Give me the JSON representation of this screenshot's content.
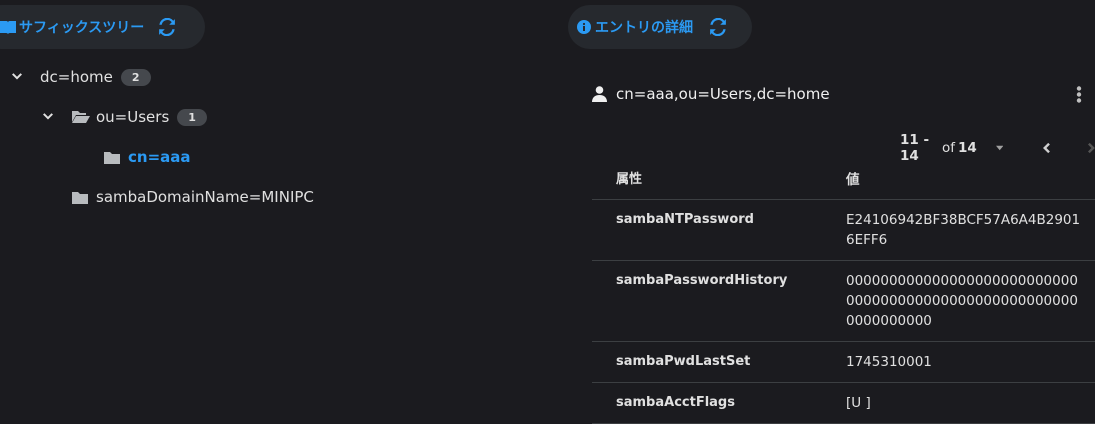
{
  "left_panel": {
    "title": "サフィックスツリー",
    "title_icon": "book-icon",
    "refresh_icon": "sync-icon"
  },
  "tree": [
    {
      "label": "dc=home",
      "count": "2",
      "expanded": true
    },
    {
      "label": "ou=Users",
      "count": "1",
      "expanded": true
    },
    {
      "label": "cn=aaa",
      "selected": true
    },
    {
      "label": "sambaDomainName=MINIPC"
    }
  ],
  "right_panel": {
    "title": "エントリの詳細",
    "title_icon": "info-circle-icon",
    "refresh_icon": "sync-icon"
  },
  "entry": {
    "dn": "cn=aaa,ou=Users,dc=home"
  },
  "pagination": {
    "range": "11 - 14",
    "of": "of",
    "total": "14"
  },
  "table": {
    "headers": [
      "属性",
      "値"
    ],
    "rows": [
      {
        "attr": "sambaNTPassword",
        "value": "E24106942BF38BCF57A6A4B29016EFF6"
      },
      {
        "attr": "sambaPasswordHistory",
        "value": "0000000000000000000000000000000000000000000000000000000000000000"
      },
      {
        "attr": "sambaPwdLastSet",
        "value": "1745310001"
      },
      {
        "attr": "sambaAcctFlags",
        "value": "[U ]"
      }
    ]
  },
  "colors": {
    "accent": "#2b9af3",
    "background": "#1b1b1f"
  }
}
